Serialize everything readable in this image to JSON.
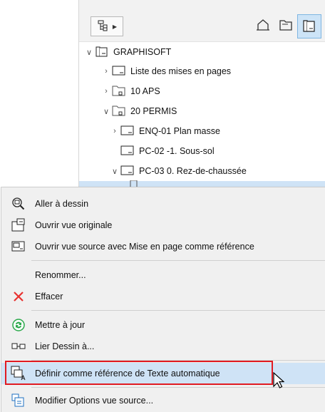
{
  "navigator": {
    "tree": [
      {
        "label": "GRAPHISOFT",
        "icon": "project-folder-icon",
        "expander": "expanded"
      },
      {
        "label": "Liste des mises en pages",
        "icon": "layout-book-icon",
        "expander": "collapsed"
      },
      {
        "label": "10 APS",
        "icon": "subset-folder-icon",
        "expander": "collapsed"
      },
      {
        "label": "20 PERMIS",
        "icon": "subset-folder-icon",
        "expander": "expanded"
      },
      {
        "label": "ENQ-01 Plan masse",
        "icon": "layout-icon",
        "expander": "collapsed"
      },
      {
        "label": "PC-02 -1. Sous-sol",
        "icon": "layout-icon",
        "expander": "none"
      },
      {
        "label": "PC-03 0. Rez-de-chaussée",
        "icon": "layout-icon",
        "expander": "expanded"
      }
    ]
  },
  "context_menu": {
    "items": [
      {
        "label": "Aller à dessin",
        "icon": "go-to-drawing-icon"
      },
      {
        "label": "Ouvrir vue originale",
        "icon": "open-view-icon"
      },
      {
        "label": "Ouvrir vue source avec Mise en page comme référence",
        "icon": "open-source-view-icon"
      },
      {
        "label": "Renommer...",
        "icon": ""
      },
      {
        "label": "Effacer",
        "icon": "delete-icon"
      },
      {
        "label": "Mettre à jour",
        "icon": "update-icon"
      },
      {
        "label": "Lier Dessin à...",
        "icon": "link-drawing-icon"
      },
      {
        "label": "Définir comme référence de Texte automatique",
        "icon": "autotext-reference-icon",
        "highlighted": true
      },
      {
        "label": "Modifier Options vue source...",
        "icon": "view-settings-icon"
      }
    ]
  },
  "colors": {
    "selection": "#cfe3f6",
    "highlight_border": "#e11b22",
    "delete_x": "#e8312f",
    "update_green": "#2aa84a"
  }
}
